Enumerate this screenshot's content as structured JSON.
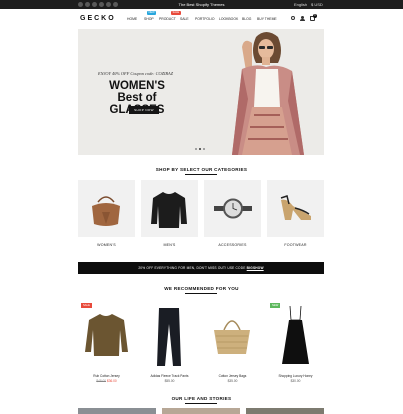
{
  "topbar": {
    "promo": "The Best Shopify Themes",
    "language": "English",
    "currency": "$ USD"
  },
  "header": {
    "logo": "GECKO",
    "nav": [
      {
        "label": "HOME"
      },
      {
        "label": "SHOP",
        "badge": "NEW",
        "badge_color": "#29a7dd"
      },
      {
        "label": "PRODUCT",
        "badge": "SALE",
        "badge_color": "#e84a3b"
      },
      {
        "label": "SALE"
      },
      {
        "label": "PORTFOLIO"
      },
      {
        "label": "LOOKBOOK"
      },
      {
        "label": "BLOG"
      },
      {
        "label": "BUY THEME"
      }
    ],
    "cart_count": "0"
  },
  "hero": {
    "coupon": "ENJOY 40% OFF Coupon code: COZIBAZ",
    "headline_1": "WOMEN'S",
    "headline_2": "Best of GLASSES",
    "button": "SHOP NOW",
    "slides": 3,
    "active_slide": 1
  },
  "categories": {
    "title": "SHOP BY SELECT OUR CATEGORIES",
    "items": [
      {
        "label": "WOMEN'S",
        "icon": "handbag-icon"
      },
      {
        "label": "MEN'S",
        "icon": "sweater-icon"
      },
      {
        "label": "ACCESSORIES",
        "icon": "watch-icon"
      },
      {
        "label": "FOOTWEAR",
        "icon": "wedge-sandal-icon"
      }
    ]
  },
  "banner": {
    "text": "20% OFF EVERYTHING FOR MEN, DON'T MISS OUT! USE CODE",
    "code": "BIGSHOW"
  },
  "products": {
    "title": "WE RECOMMENDED FOR YOU",
    "items": [
      {
        "name": "Rub Cotton Jersey",
        "old_price": "$48.00",
        "price": "$36.00",
        "tag": "SALE",
        "tag_color": "#e84a3b",
        "icon": "knit-sweater-icon"
      },
      {
        "name": "Adidas Fleece Track Pants",
        "price": "$55.00",
        "icon": "track-pants-icon"
      },
      {
        "name": "Cotton Jersey Bags",
        "price": "$35.00",
        "icon": "straw-bag-icon"
      },
      {
        "name": "Shopping Luxury Honey",
        "price": "$30.00",
        "tag": "NEW",
        "tag_color": "#5cb85c",
        "icon": "slip-dress-icon"
      }
    ]
  },
  "stories": {
    "title": "OUR LIFE AND STORIES"
  }
}
